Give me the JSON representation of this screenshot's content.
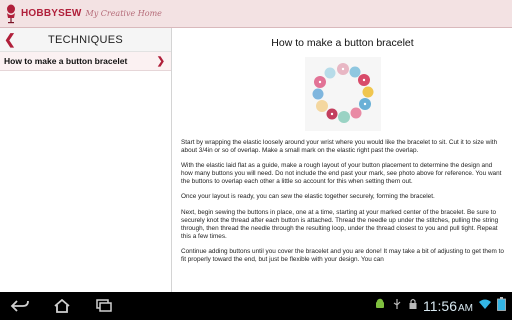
{
  "app": {
    "brand": "HOBBYSEW",
    "tagline": "My Creative Home"
  },
  "sidebar": {
    "title": "TECHNIQUES",
    "items": [
      {
        "label": "How to make a button bracelet"
      }
    ]
  },
  "article": {
    "title": "How to make a button bracelet",
    "paragraphs": [
      "Start by wrapping the elastic loosely around your wrist where you would like the bracelet to sit. Cut it to size with about 3/4in or so of overlap. Make a small mark on the elastic right past the overlap.",
      "With the elastic laid flat as a guide, make a rough layout of your button placement to determine the design and how many buttons you will need. Do not include the end past your mark, see photo above for reference. You want the buttons to overlap each other a little so account for this when setting them out.",
      "Once your layout is ready, you can sew the elastic together securely, forming the bracelet.",
      "Next, begin sewing the buttons in place, one at a time, starting at your marked center of the bracelet. Be sure to securely knot the thread after each button is attached. Thread the needle up under the stitches, pulling the string through, then thread the needle through the resulting loop, under the thread closest to you and pull tight. Repeat this a few times.",
      "Continue adding buttons until you cover the bracelet and you are done! It may take a bit of adjusting to get them to fit properly toward the end, but just be flexible with your design. You can"
    ]
  },
  "system_bar": {
    "time": "11:56",
    "ampm": "AM"
  },
  "colors": {
    "accent": "#b01f3a",
    "header_bg": "#f3e2e3",
    "selected_row_bg": "#fbf1f2"
  }
}
